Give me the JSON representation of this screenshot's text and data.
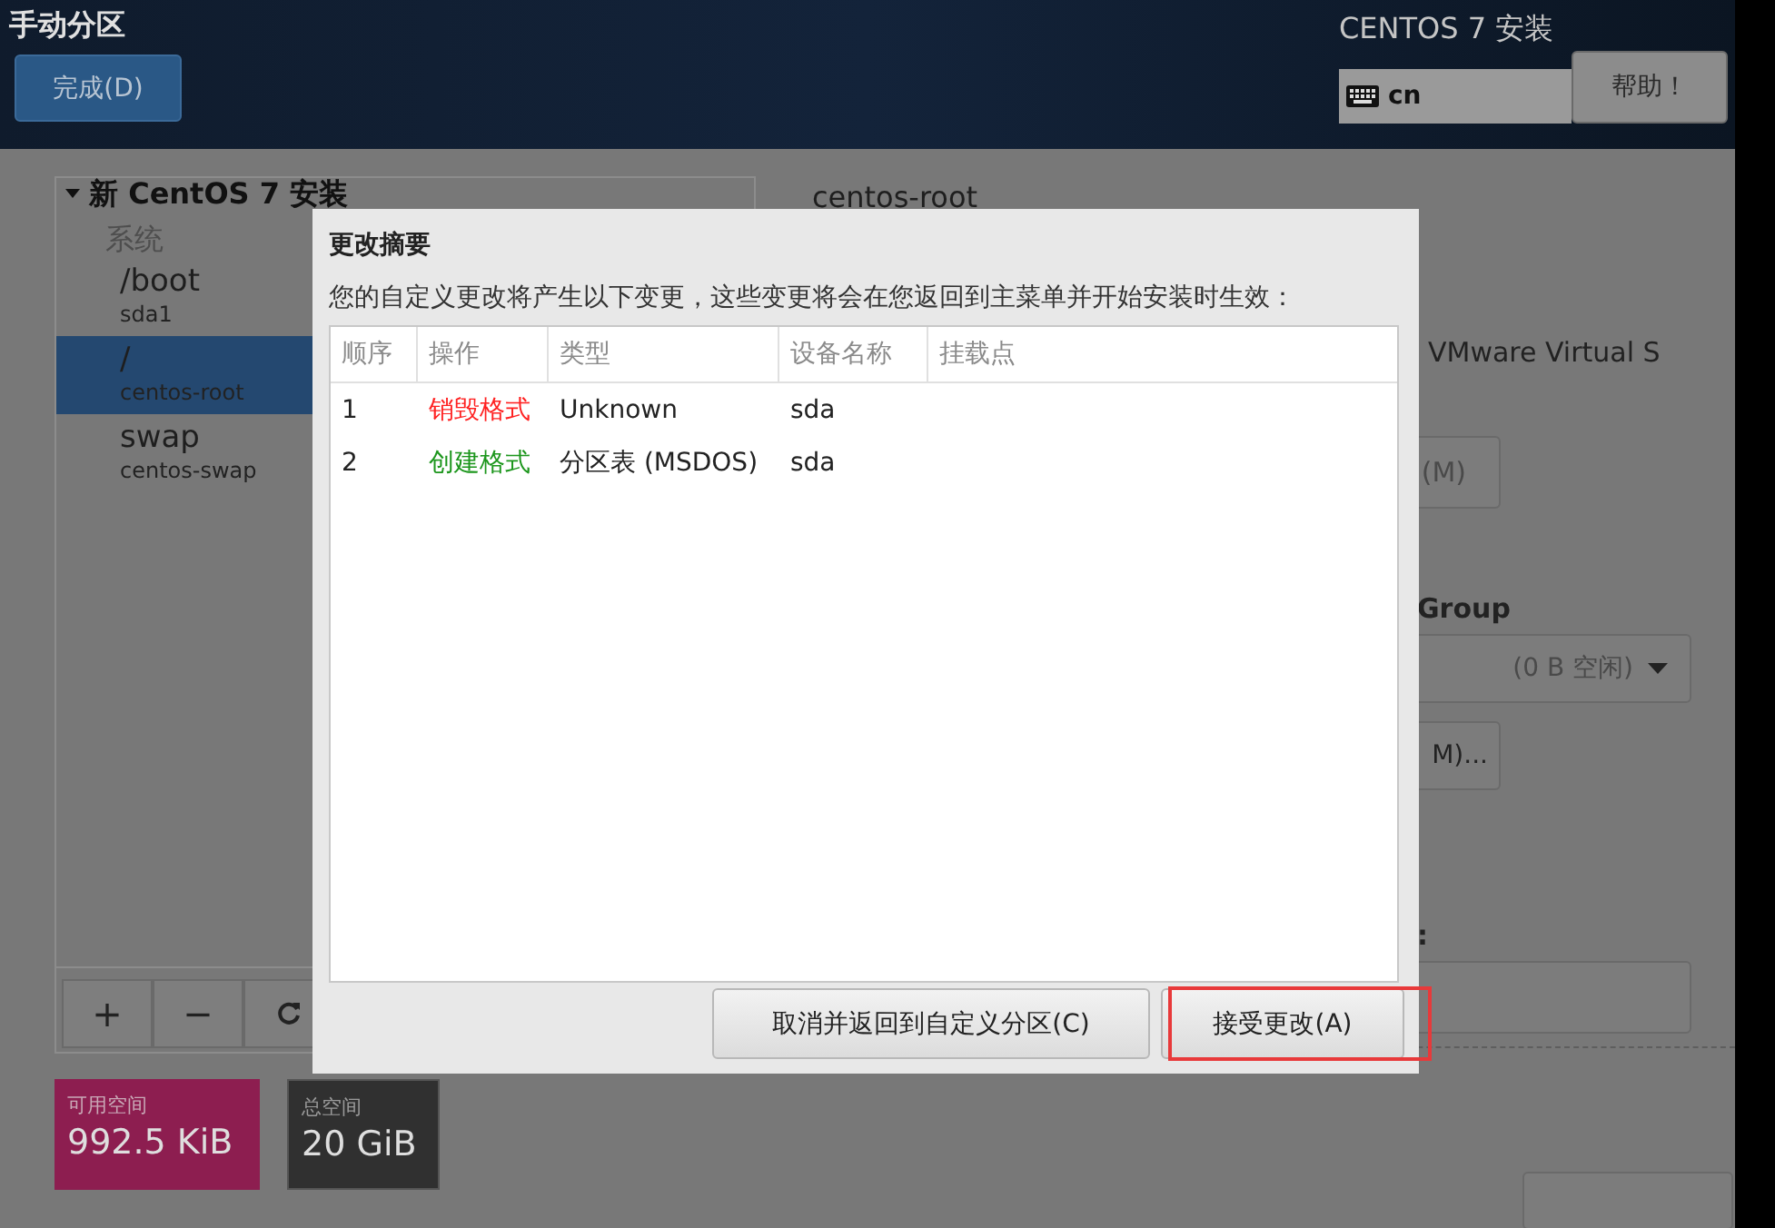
{
  "header": {
    "title": "手动分区",
    "done_button": "完成(D)",
    "product": "CENTOS 7 安装",
    "keyboard_layout": "cn",
    "help_button": "帮助！"
  },
  "partitions": {
    "group": "新 CentOS 7 安装",
    "expanded": true,
    "section": "系统",
    "items": [
      {
        "mount": "/boot",
        "device": "sda1",
        "selected": false
      },
      {
        "mount": "/",
        "device": "centos-root",
        "selected": true
      },
      {
        "mount": "swap",
        "device": "centos-swap",
        "selected": false
      }
    ]
  },
  "toolbar": [
    {
      "kind": "add",
      "label": "+"
    },
    {
      "kind": "remove",
      "label": "−"
    },
    {
      "kind": "refresh"
    }
  ],
  "space": [
    {
      "kind": "available",
      "label": "可用空间",
      "value": "992.5 KiB"
    },
    {
      "kind": "total",
      "label": "总空间",
      "value": "20 GiB"
    }
  ],
  "details": {
    "title": "centos-root",
    "device_text": "VMware Virtual S",
    "modify_button": "(M)",
    "group_label": "Group",
    "group_dropdown": "(0 B 空闲)",
    "group_modify_button": "M)...",
    "name_label": ":"
  },
  "dialog": {
    "title": "更改摘要",
    "description": "您的自定义更改将产生以下变更，这些变更将会在您返回到主菜单并开始安装时生效：",
    "columns": [
      "顺序",
      "操作",
      "类型",
      "设备名称",
      "挂载点"
    ],
    "rows": [
      {
        "order": "1",
        "action": "销毁格式",
        "color": "#ff2020",
        "type": "Unknown",
        "device": "sda"
      },
      {
        "order": "2",
        "action": "创建格式",
        "color": "#1c961c",
        "type": "分区表 (MSDOS)",
        "device": "sda"
      }
    ],
    "buttons": [
      {
        "label": "取消并返回到自定义分区(C)",
        "highlighted": false
      },
      {
        "label": "接受更改(A)",
        "highlighted": true
      }
    ]
  }
}
